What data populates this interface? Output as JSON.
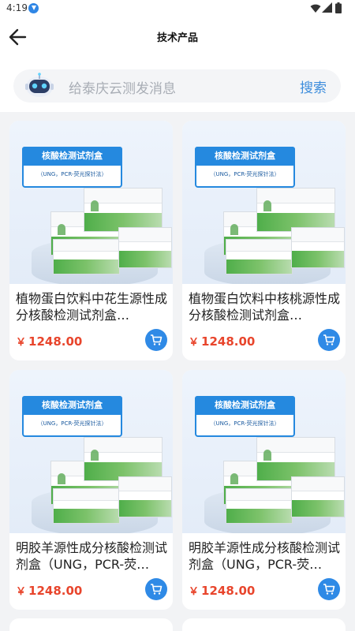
{
  "status_bar": {
    "time": "4:19",
    "notification_icon": "download-notification-icon",
    "icons": [
      "wifi-icon",
      "signal-icon",
      "battery-icon"
    ]
  },
  "header": {
    "back_icon": "arrow-left-icon",
    "title": "技术产品"
  },
  "search": {
    "avatar_icon": "robot-assistant-icon",
    "placeholder": "给泰庆云测发消息",
    "button_label": "搜索"
  },
  "product_image": {
    "banner_title": "核酸检测试剂盒",
    "banner_subtitle": "（UNG，PCR-荧光探针法）"
  },
  "products": [
    {
      "name": "植物蛋白饮料中花生源性成分核酸检测试剂盒…",
      "price_symbol": "￥",
      "price": "1248.00"
    },
    {
      "name": "植物蛋白饮料中核桃源性成分核酸检测试剂盒…",
      "price_symbol": "￥",
      "price": "1248.00"
    },
    {
      "name": "明胶羊源性成分核酸检测试剂盒（UNG，PCR-荧…",
      "price_symbol": "￥",
      "price": "1248.00"
    },
    {
      "name": "明胶羊源性成分核酸检测试剂盒（UNG，PCR-荧…",
      "price_symbol": "￥",
      "price": "1248.00"
    }
  ],
  "cart_icon": "shopping-cart-icon",
  "colors": {
    "accent": "#2f8ae6",
    "price": "#e8452c",
    "banner": "#2589df",
    "background": "#f2f3f5"
  }
}
